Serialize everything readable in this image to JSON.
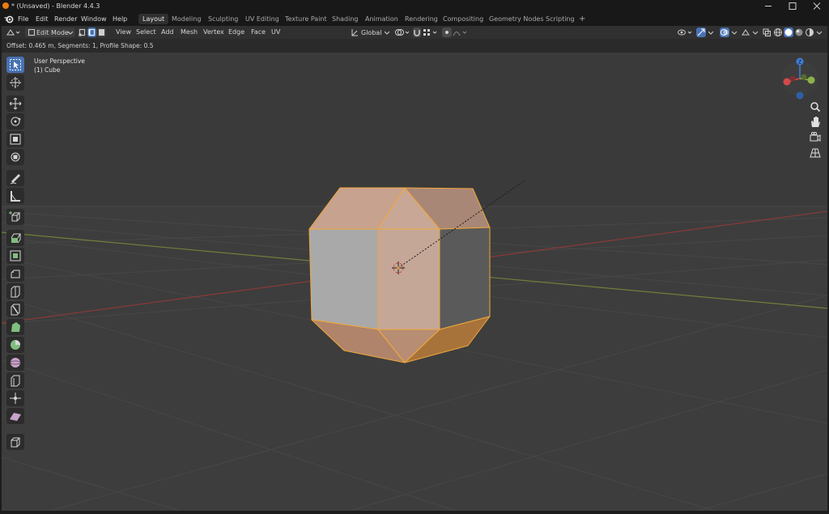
{
  "window": {
    "title": "* (Unsaved) - Blender 4.4.3"
  },
  "menu": {
    "items": [
      "File",
      "Edit",
      "Render",
      "Window",
      "Help"
    ]
  },
  "workspaces": [
    {
      "label": "Layout",
      "active": true
    },
    {
      "label": "Modeling",
      "active": false
    },
    {
      "label": "Sculpting",
      "active": false
    },
    {
      "label": "UV Editing",
      "active": false
    },
    {
      "label": "Texture Paint",
      "active": false
    },
    {
      "label": "Shading",
      "active": false
    },
    {
      "label": "Animation",
      "active": false
    },
    {
      "label": "Rendering",
      "active": false
    },
    {
      "label": "Compositing",
      "active": false
    },
    {
      "label": "Geometry Nodes",
      "active": false
    },
    {
      "label": "Scripting",
      "active": false
    }
  ],
  "add_workspace": "+",
  "header": {
    "mode": "Edit Mode",
    "menus": [
      "View",
      "Select",
      "Add",
      "Mesh",
      "Vertex",
      "Edge",
      "Face",
      "UV"
    ],
    "transform_orientation": "Global"
  },
  "operator_panel": {
    "text": "Offset: 0.465 m, Segments: 1, Profile Shape: 0.5"
  },
  "viewport": {
    "view_name": "User Perspective",
    "object_name": "(1) Cube"
  },
  "gizmo": {
    "z_label": "Z",
    "x_label": "X",
    "y_label": "Y"
  },
  "toolbar_tools": [
    "select-box-tool",
    "cursor-tool",
    "move-tool",
    "rotate-tool",
    "scale-tool",
    "transform-tool",
    "annotate-tool",
    "measure-tool",
    "add-cube-tool",
    "extrude-region-tool",
    "inset-faces-tool",
    "bevel-tool",
    "loop-cut-tool",
    "knife-tool",
    "poly-build-tool",
    "spin-tool",
    "smooth-tool",
    "edge-slide-tool",
    "shrink-fatten-tool",
    "shear-tool",
    "rip-region-tool"
  ],
  "colors": {
    "accent": "#4772b3",
    "selection": "#e8a53a",
    "x_axis": "#d34a4a",
    "y_axis": "#8cb34a",
    "z_axis": "#3f7fdc"
  }
}
